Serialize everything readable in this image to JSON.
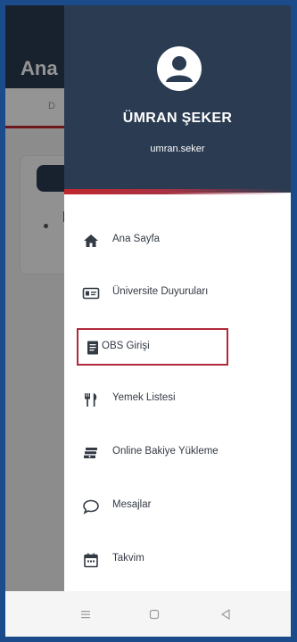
{
  "background_app": {
    "title": "Ana",
    "tab_label": "D"
  },
  "drawer": {
    "user": {
      "name": "ÜMRAN ŞEKER",
      "username": "umran.seker"
    },
    "items": [
      {
        "label": "Ana Sayfa",
        "icon": "home-icon"
      },
      {
        "label": "Üniversite Duyuruları",
        "icon": "id-card-icon"
      },
      {
        "label": "OBS Girişi",
        "icon": "document-icon",
        "selected": true
      },
      {
        "label": "Yemek Listesi",
        "icon": "utensils-icon"
      },
      {
        "label": "Online Bakiye Yükleme",
        "icon": "money-icon"
      },
      {
        "label": "Mesajlar",
        "icon": "chat-icon"
      },
      {
        "label": "Takvim",
        "icon": "calendar-icon"
      }
    ]
  },
  "navbar": {
    "buttons": [
      "menu-icon",
      "home-square-icon",
      "back-triangle-icon"
    ]
  },
  "colors": {
    "header": "#2a3b52",
    "accent": "#c0272d",
    "selected_border": "#b0293a",
    "frame": "#1c4b8c"
  }
}
